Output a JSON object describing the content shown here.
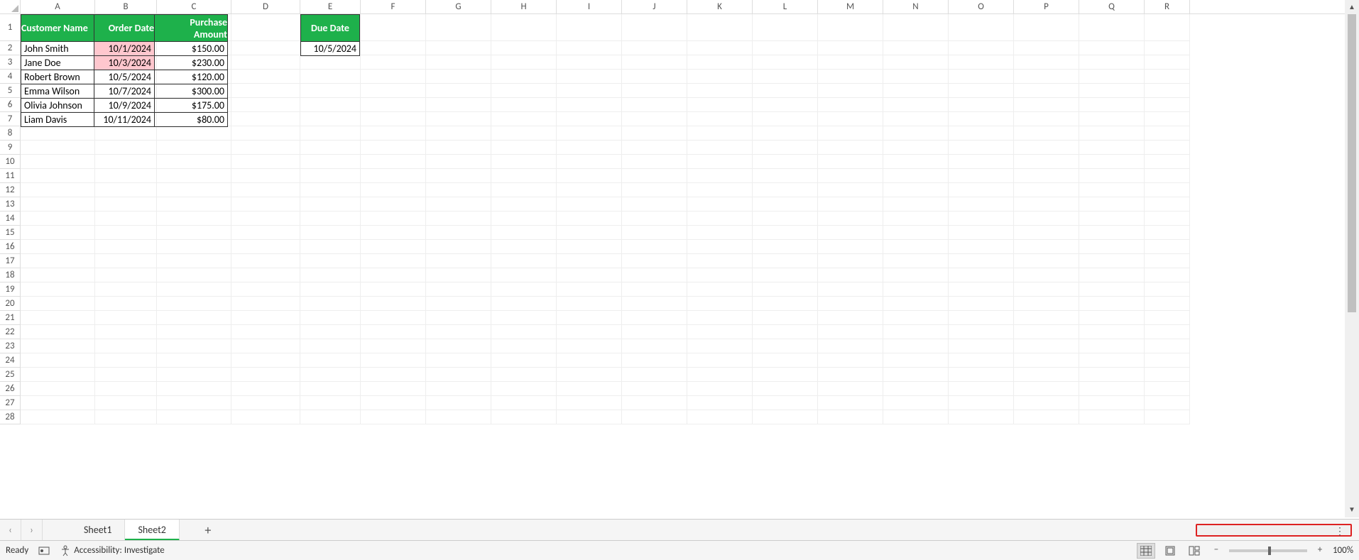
{
  "columns": [
    "A",
    "B",
    "C",
    "D",
    "E",
    "F",
    "G",
    "H",
    "I",
    "J",
    "K",
    "L",
    "M",
    "N",
    "O",
    "P",
    "Q",
    "R"
  ],
  "rows": [
    "1",
    "2",
    "3",
    "4",
    "5",
    "6",
    "7",
    "8",
    "9",
    "10",
    "11",
    "12",
    "13",
    "14",
    "15",
    "16",
    "17",
    "18",
    "19",
    "20",
    "21",
    "22",
    "23",
    "24",
    "25",
    "26",
    "27",
    "28"
  ],
  "table1": {
    "headers": {
      "A": "Customer Name",
      "B": "Order Date",
      "C": "Purchase Amount"
    },
    "data": [
      {
        "name": "John Smith",
        "date": "10/1/2024",
        "amount": "$150.00",
        "highlight": true
      },
      {
        "name": "Jane Doe",
        "date": "10/3/2024",
        "amount": "$230.00",
        "highlight": true
      },
      {
        "name": "Robert Brown",
        "date": "10/5/2024",
        "amount": "$120.00",
        "highlight": false
      },
      {
        "name": "Emma Wilson",
        "date": "10/7/2024",
        "amount": "$300.00",
        "highlight": false
      },
      {
        "name": "Olivia Johnson",
        "date": "10/9/2024",
        "amount": "$175.00",
        "highlight": false
      },
      {
        "name": "Liam Davis",
        "date": "10/11/2024",
        "amount": "$80.00",
        "highlight": false
      }
    ]
  },
  "table2": {
    "header": "Due Date",
    "value": "10/5/2024"
  },
  "sheets": {
    "items": [
      {
        "name": "Sheet1",
        "active": false
      },
      {
        "name": "Sheet2",
        "active": true
      }
    ]
  },
  "status": {
    "ready": "Ready",
    "accessibility": "Accessibility: Investigate",
    "zoom": "100%"
  }
}
